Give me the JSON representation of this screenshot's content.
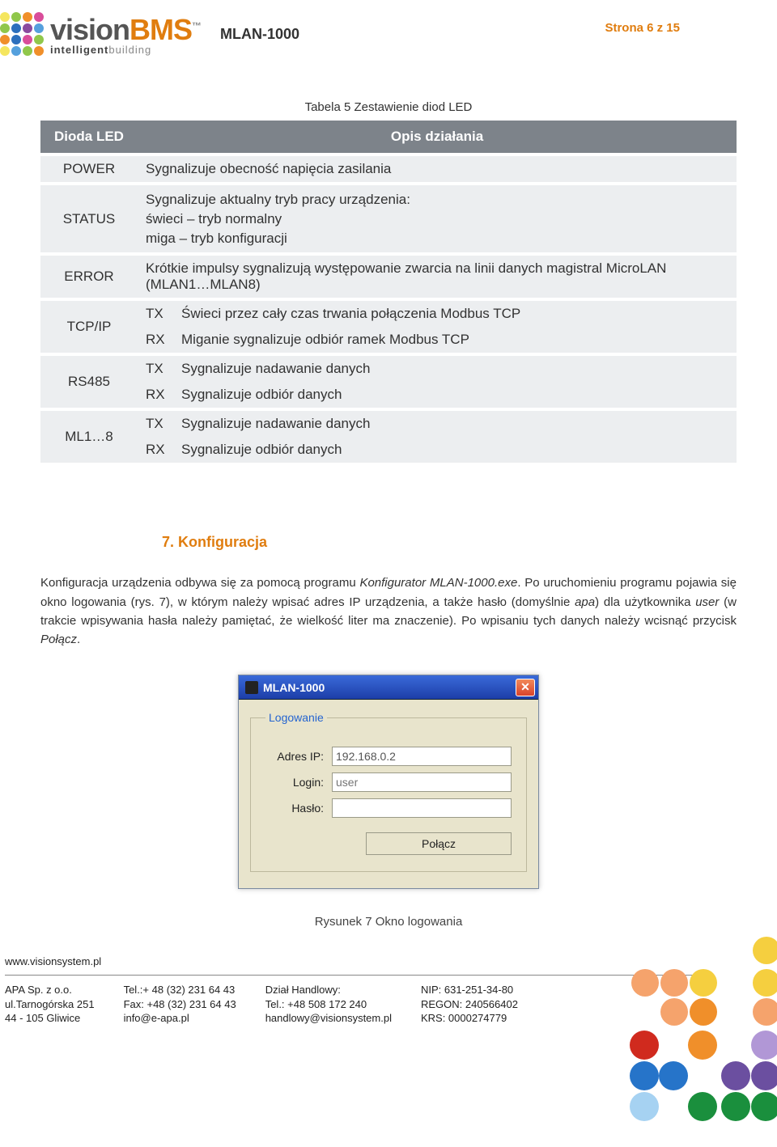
{
  "header": {
    "doc_title": "MLAN-1000",
    "page_label": "Strona 6 z 15",
    "logo_main_a": "vision",
    "logo_main_b": "BMS",
    "logo_tm": "™",
    "logo_sub_a": "intelligent",
    "logo_sub_b": "building"
  },
  "table": {
    "caption": "Tabela 5 Zestawienie diod LED",
    "hdr_led": "Dioda LED",
    "hdr_desc": "Opis działania",
    "rows": {
      "power_label": "POWER",
      "power_desc": "Sygnalizuje obecność napięcia zasilania",
      "status_label": "STATUS",
      "status_line1": "Sygnalizuje aktualny tryb pracy urządzenia:",
      "status_line2": "świeci – tryb normalny",
      "status_line3": "miga – tryb konfiguracji",
      "error_label": "ERROR",
      "error_desc": "Krótkie impulsy sygnalizują występowanie zwarcia na linii danych magistral MicroLAN (MLAN1…MLAN8)",
      "tcpip_label": "TCP/IP",
      "tcpip_tx_lbl": "TX",
      "tcpip_tx_desc": "Świeci przez cały czas trwania połączenia Modbus TCP",
      "tcpip_rx_lbl": "RX",
      "tcpip_rx_desc": "Miganie sygnalizuje odbiór ramek Modbus TCP",
      "rs485_label": "RS485",
      "rs485_tx_lbl": "TX",
      "rs485_tx_desc": "Sygnalizuje nadawanie danych",
      "rs485_rx_lbl": "RX",
      "rs485_rx_desc": "Sygnalizuje odbiór danych",
      "ml_label": "ML1…8",
      "ml_tx_lbl": "TX",
      "ml_tx_desc": "Sygnalizuje nadawanie danych",
      "ml_rx_lbl": "RX",
      "ml_rx_desc": "Sygnalizuje odbiór danych"
    }
  },
  "section": {
    "title": "7. Konfiguracja",
    "p1a": "Konfiguracja urządzenia odbywa się za pomocą programu ",
    "p1b_it": "Konfigurator MLAN-1000.exe",
    "p1c": ". Po uruchomieniu programu pojawia się okno logowania (rys. 7), w którym należy wpisać adres IP urządzenia, a także hasło (domyślnie ",
    "p1d_it": "apa",
    "p1e": ") dla użytkownika ",
    "p1f_it": "user",
    "p1g": " (w trakcie wpisywania hasła należy pamiętać, że wielkość liter ma znaczenie). Po wpisaniu tych danych należy wcisnąć przycisk ",
    "p1h_it": "Połącz",
    "p1i": "."
  },
  "dialog": {
    "title": "MLAN-1000",
    "legend": "Logowanie",
    "ip_label": "Adres IP:",
    "ip_value": "192.168.0.2",
    "login_label": "Login:",
    "login_placeholder": "user",
    "password_label": "Hasło:",
    "password_value": "",
    "connect_label": "Połącz"
  },
  "figure_caption": "Rysunek 7 Okno logowania",
  "footer": {
    "url": "www.visionsystem.pl",
    "col1_l1": "APA Sp. z o.o.",
    "col1_l2": "ul.Tarnogórska 251",
    "col1_l3": "44 - 105 Gliwice",
    "col2_l1": "Tel.:+ 48 (32) 231 64 43",
    "col2_l2": "Fax: +48 (32) 231 64 43",
    "col2_l3": "info@e-apa.pl",
    "col3_l1": "Dział Handlowy:",
    "col3_l2": "Tel.: +48 508 172 240",
    "col3_l3": "handlowy@visionsystem.pl",
    "col4_l1": "NIP: 631-251-34-80",
    "col4_l2": "REGON: 240566402",
    "col4_l3": "KRS: 0000274779"
  }
}
